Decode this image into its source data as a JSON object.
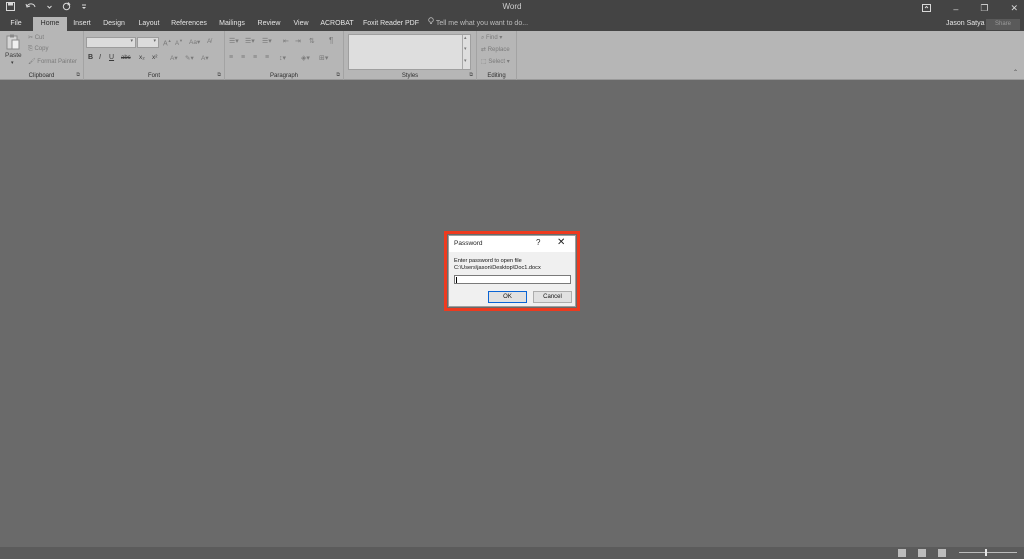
{
  "app": {
    "title": "Word"
  },
  "qat": {
    "save_icon": "save-icon",
    "undo_icon": "undo-icon",
    "redo_icon": "redo-icon",
    "customize_icon": "customize-icon"
  },
  "window": {
    "ribbon_display_icon": "ribbon-display-icon",
    "minimize": "–",
    "restore": "❐",
    "close": "✕"
  },
  "tabs": [
    {
      "label": "File"
    },
    {
      "label": "Home"
    },
    {
      "label": "Insert"
    },
    {
      "label": "Design"
    },
    {
      "label": "Layout"
    },
    {
      "label": "References"
    },
    {
      "label": "Mailings"
    },
    {
      "label": "Review"
    },
    {
      "label": "View"
    },
    {
      "label": "ACROBAT"
    },
    {
      "label": "Foxit Reader PDF"
    }
  ],
  "tellme": {
    "placeholder": "Tell me what you want to do..."
  },
  "user": {
    "name": "Jason Satya"
  },
  "share": {
    "label": "Share"
  },
  "ribbon": {
    "clipboard": {
      "paste": "Paste",
      "cut": "Cut",
      "copy": "Copy",
      "format_painter": "Format Painter",
      "label": "Clipboard"
    },
    "font": {
      "label": "Font",
      "bold": "B",
      "italic": "I",
      "underline": "U",
      "strike": "abc",
      "subscript": "x₂",
      "superscript": "x²"
    },
    "paragraph": {
      "label": "Paragraph",
      "pilcrow": "¶"
    },
    "styles": {
      "label": "Styles"
    },
    "editing": {
      "label": "Editing",
      "find": "Find",
      "replace": "Replace",
      "select": "Select"
    }
  },
  "dialog": {
    "title": "Password",
    "help": "?",
    "close": "✕",
    "prompt": "Enter password to open file",
    "path": "C:\\Users\\jason\\Desktop\\Doc1.docx",
    "password_value": "",
    "ok": "OK",
    "cancel": "Cancel"
  },
  "colors": {
    "highlight": "#ee3a1f",
    "titlebar": "#444444",
    "ribbon": "#b6b6b6",
    "workspace": "#6a6a6a"
  }
}
